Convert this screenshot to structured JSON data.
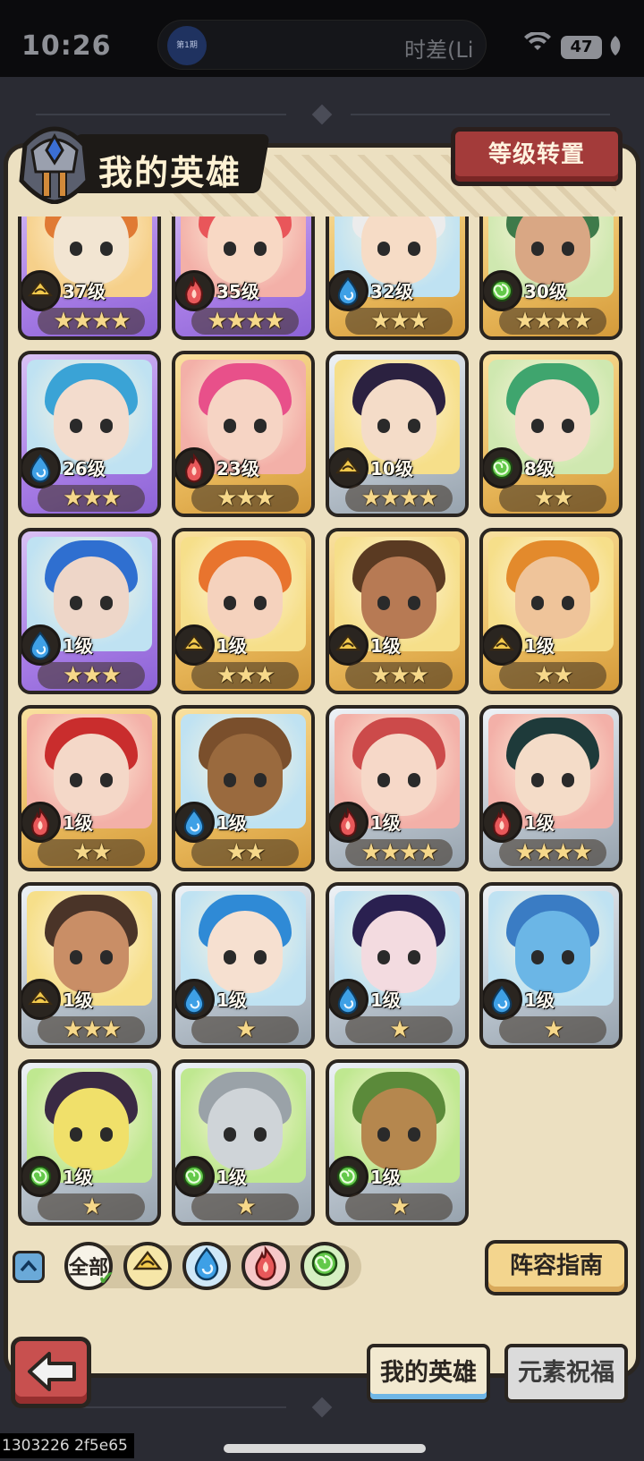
{
  "status_bar": {
    "time": "10:26",
    "carrier": "时差(Li",
    "battery": "47",
    "pill_logo": "第1期"
  },
  "header": {
    "title": "我的英雄",
    "level_reset_button": "等级转置"
  },
  "element_colors": {
    "earth": "#f2c94c",
    "water": "#3ea0e6",
    "fire": "#e8585a",
    "wind": "#63c94a"
  },
  "element_icons": {
    "earth": "earth-icon",
    "water": "water-drop-icon",
    "fire": "fire-icon",
    "wind": "wind-swirl-icon"
  },
  "heroes": [
    {
      "level": "37级",
      "element": "earth",
      "stars": "★★★★",
      "frame": "purple",
      "skin": "#f2e5d2",
      "hair": "#e07a34",
      "bg": "#f6d08a"
    },
    {
      "level": "35级",
      "element": "fire",
      "stars": "★★★★",
      "frame": "purple",
      "skin": "#f8d8c4",
      "hair": "#e9565a",
      "bg": "#f3b0a8"
    },
    {
      "level": "32级",
      "element": "water",
      "stars": "★★★",
      "frame": "gold",
      "skin": "#f6dcc6",
      "hair": "#ececec",
      "bg": "#bfe2f2"
    },
    {
      "level": "30级",
      "element": "wind",
      "stars": "★★★★",
      "frame": "gold",
      "skin": "#d9a784",
      "hair": "#3e7a4a",
      "bg": "#cfe8b0"
    },
    {
      "level": "26级",
      "element": "water",
      "stars": "★★★",
      "frame": "purple",
      "skin": "#f3dccd",
      "hair": "#3aa3d6",
      "bg": "#bfe2f2"
    },
    {
      "level": "23级",
      "element": "fire",
      "stars": "★★★",
      "frame": "gold",
      "skin": "#f6d4c4",
      "hair": "#e8508a",
      "bg": "#f3b0a8"
    },
    {
      "level": "10级",
      "element": "earth",
      "stars": "★★★★",
      "frame": "silver",
      "skin": "#f4dcc8",
      "hair": "#2b2140",
      "bg": "#f6df8a"
    },
    {
      "level": "8级",
      "element": "wind",
      "stars": "★★",
      "frame": "gold",
      "skin": "#f5dccb",
      "hair": "#3fa56e",
      "bg": "#cfe8b0"
    },
    {
      "level": "1级",
      "element": "water",
      "stars": "★★★",
      "frame": "purple",
      "skin": "#eed6c8",
      "hair": "#2f6fd0",
      "bg": "#bfe2f2"
    },
    {
      "level": "1级",
      "element": "earth",
      "stars": "★★★",
      "frame": "gold",
      "skin": "#f5d2bd",
      "hair": "#e8742e",
      "bg": "#f6df8a"
    },
    {
      "level": "1级",
      "element": "earth",
      "stars": "★★★",
      "frame": "gold",
      "skin": "#b77a54",
      "hair": "#5a3a22",
      "bg": "#f6df8a"
    },
    {
      "level": "1级",
      "element": "earth",
      "stars": "★★",
      "frame": "gold",
      "skin": "#efc49a",
      "hair": "#e38a2c",
      "bg": "#f6df8a"
    },
    {
      "level": "1级",
      "element": "fire",
      "stars": "★★",
      "frame": "gold",
      "skin": "#f4d8c8",
      "hair": "#c92d2d",
      "bg": "#f3b0a8"
    },
    {
      "level": "1级",
      "element": "water",
      "stars": "★★",
      "frame": "gold",
      "skin": "#9a6a3e",
      "hair": "#7a4f2c",
      "bg": "#bfe2f2"
    },
    {
      "level": "1级",
      "element": "fire",
      "stars": "★★★★",
      "frame": "silver",
      "skin": "#f6d8c8",
      "hair": "#cc4a4a",
      "bg": "#f3b0a8"
    },
    {
      "level": "1级",
      "element": "fire",
      "stars": "★★★★",
      "frame": "silver",
      "skin": "#f4dcc8",
      "hair": "#1e3a3a",
      "bg": "#f3b0a8"
    },
    {
      "level": "1级",
      "element": "earth",
      "stars": "★★★",
      "frame": "silver",
      "skin": "#c98e66",
      "hair": "#4a3428",
      "bg": "#f6df8a"
    },
    {
      "level": "1级",
      "element": "water",
      "stars": "★",
      "frame": "silver",
      "skin": "#f6e0d0",
      "hair": "#2f8ad6",
      "bg": "#bfe2f2"
    },
    {
      "level": "1级",
      "element": "water",
      "stars": "★",
      "frame": "silver",
      "skin": "#f3dbe0",
      "hair": "#2a2050",
      "bg": "#bfe2f2"
    },
    {
      "level": "1级",
      "element": "water",
      "stars": "★",
      "frame": "silver",
      "skin": "#6bb6e6",
      "hair": "#3a7cc4",
      "bg": "#bfe2f2"
    },
    {
      "level": "1级",
      "element": "wind",
      "stars": "★",
      "frame": "silver",
      "skin": "#f0e06a",
      "hair": "#3a2a44",
      "bg": "#bfe890"
    },
    {
      "level": "1级",
      "element": "wind",
      "stars": "★",
      "frame": "silver",
      "skin": "#cfd4d8",
      "hair": "#9aa2a8",
      "bg": "#bfe890"
    },
    {
      "level": "1级",
      "element": "wind",
      "stars": "★",
      "frame": "silver",
      "skin": "#b5874e",
      "hair": "#5b8a3a",
      "bg": "#bfe890"
    }
  ],
  "filters": {
    "all_label": "全部",
    "items": [
      "earth",
      "water",
      "fire",
      "wind"
    ]
  },
  "guide_button": "阵容指南",
  "tabs": {
    "my_heroes": "我的英雄",
    "element_blessing": "元素祝福"
  },
  "bottom_id": "1303226 2f5e65"
}
